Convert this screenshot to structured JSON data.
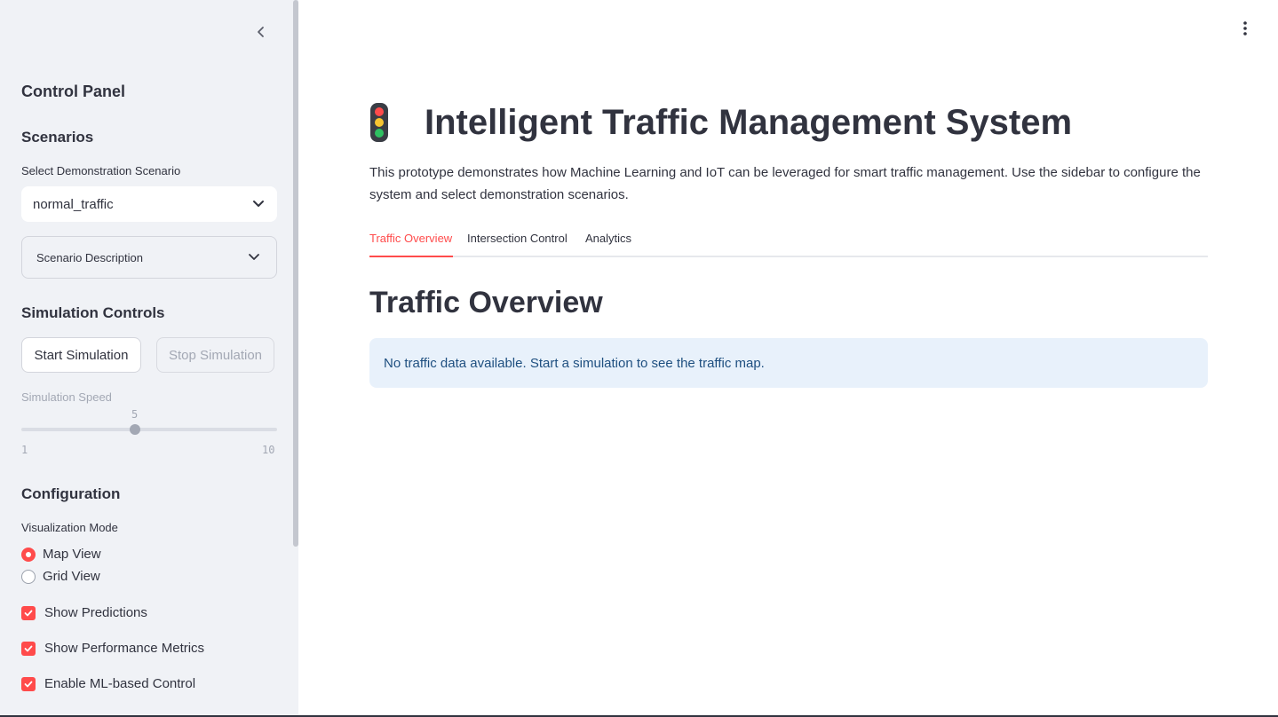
{
  "sidebar": {
    "title": "Control Panel",
    "scenarios": {
      "heading": "Scenarios",
      "select_label": "Select Demonstration Scenario",
      "select_value": "normal_traffic",
      "expander_label": "Scenario Description"
    },
    "simulation": {
      "heading": "Simulation Controls",
      "start_label": "Start Simulation",
      "stop_label": "Stop Simulation",
      "speed_label": "Simulation Speed",
      "speed_value": "5",
      "speed_min": "1",
      "speed_max": "10",
      "speed_level": 0.444
    },
    "configuration": {
      "heading": "Configuration",
      "mode_label": "Visualization Mode",
      "modes": [
        {
          "label": "Map View",
          "selected": true
        },
        {
          "label": "Grid View",
          "selected": false
        }
      ],
      "checkboxes": [
        {
          "label": "Show Predictions",
          "checked": true
        },
        {
          "label": "Show Performance Metrics",
          "checked": true
        },
        {
          "label": "Enable ML-based Control",
          "checked": true
        }
      ]
    }
  },
  "main": {
    "title_icon": "traffic-light-icon",
    "title": "Intelligent Traffic Management System",
    "description": "This prototype demonstrates how Machine Learning and IoT can be leveraged for smart traffic management. Use the sidebar to configure the system and select demonstration scenarios.",
    "tabs": [
      {
        "label": "Traffic Overview",
        "active": true
      },
      {
        "label": "Intersection Control",
        "active": false
      },
      {
        "label": "Analytics",
        "active": false
      }
    ],
    "section_title": "Traffic Overview",
    "info_message": "No traffic data available. Start a simulation to see the traffic map."
  },
  "colors": {
    "accent": "#ff4b4b",
    "sidebar_bg": "#f0f2f6",
    "info_bg": "#e8f1fb",
    "info_text": "#1e4f80",
    "text": "#31333f"
  }
}
